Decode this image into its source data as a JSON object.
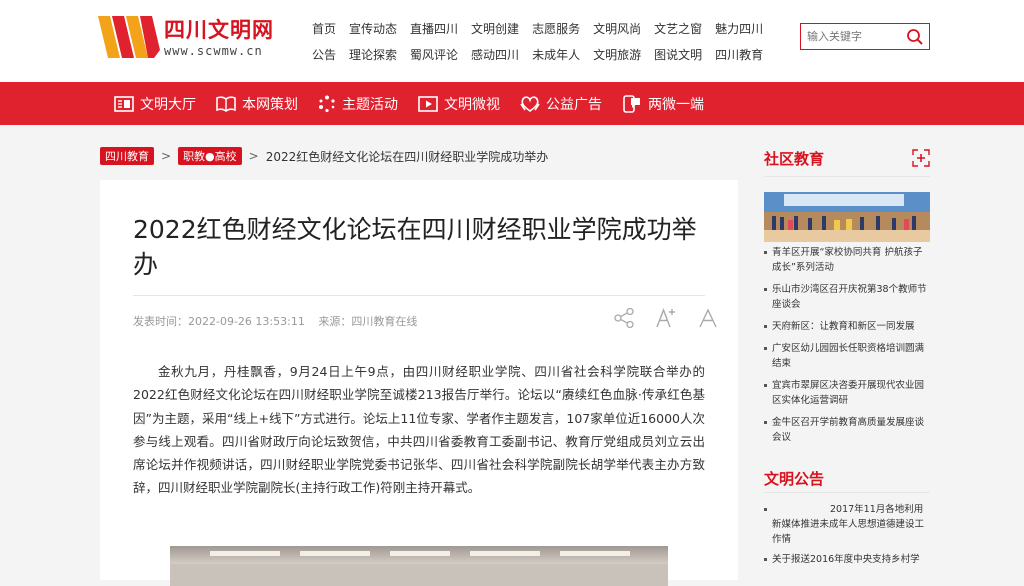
{
  "header": {
    "logo_text": "四川文明网",
    "logo_url": "www.scwmw.cn",
    "nav_row1": [
      "首页",
      "宣传动态",
      "直播四川",
      "文明创建",
      "志愿服务",
      "文明风尚",
      "文艺之窗",
      "魅力四川"
    ],
    "nav_row2": [
      "公告",
      "理论探索",
      "蜀风评论",
      "感动四川",
      "未成年人",
      "文明旅游",
      "图说文明",
      "四川教育"
    ],
    "search_placeholder": "输入关键字",
    "brand_color": "#d7131f"
  },
  "channel_nav": [
    {
      "label": "文明大厅",
      "icon": "hall-icon"
    },
    {
      "label": "本网策划",
      "icon": "book-icon"
    },
    {
      "label": "主题活动",
      "icon": "dots-circle-icon"
    },
    {
      "label": "文明微视",
      "icon": "play-icon"
    },
    {
      "label": "公益广告",
      "icon": "heart-hands-icon"
    },
    {
      "label": "两微一端",
      "icon": "mobile-chat-icon"
    }
  ],
  "breadcrumb": {
    "tag1": "四川教育",
    "tag2": "职教●高校",
    "separator": ">",
    "current": "2022红色财经文化论坛在四川财经职业学院成功举办"
  },
  "article": {
    "title": "2022红色财经文化论坛在四川财经职业学院成功举办",
    "publish_time": "发表时间：2022-09-26 13:53:11",
    "source": "来源：四川教育在线",
    "body": "金秋九月，丹桂飘香，9月24日上午9点，由四川财经职业学院、四川省社会科学院联合举办的2022红色财经文化论坛在四川财经职业学院至诚楼213报告厅举行。论坛以“赓续红色血脉·传承红色基因”为主题，采用“线上+线下”方式进行。论坛上11位专家、学者作主题发言，107家单位近16000人次参与线上观看。四川省财政厅向论坛致贺信，中共四川省委教育工委副书记、教育厅党组成员刘立云出席论坛并作视频讲话，四川财经职业学院党委书记张华、四川省社会科学院副院长胡学举代表主办方致辞，四川财经职业学院副院长(主持行政工作)符刚主持开幕式。"
  },
  "sidebar": {
    "community_title": "社区教育",
    "community_items": [
      "青羊区开展“家校协同共育 护航孩子成长”系列活动",
      "乐山市沙湾区召开庆祝第38个教师节座谈会",
      "天府新区：让教育和新区一同发展",
      "广安区幼儿园园长任职资格培训圆满结束",
      "宜宾市翠屏区决咨委开展现代农业园区实体化运营调研",
      "金牛区召开学前教育高质量发展座谈会议"
    ],
    "notice_title": "文明公告",
    "notice_items": [
      "2017年11月各地利用新媒体推进未成年人思想道德建设工作情",
      "关于报送2016年度中央支持乡村学"
    ]
  }
}
